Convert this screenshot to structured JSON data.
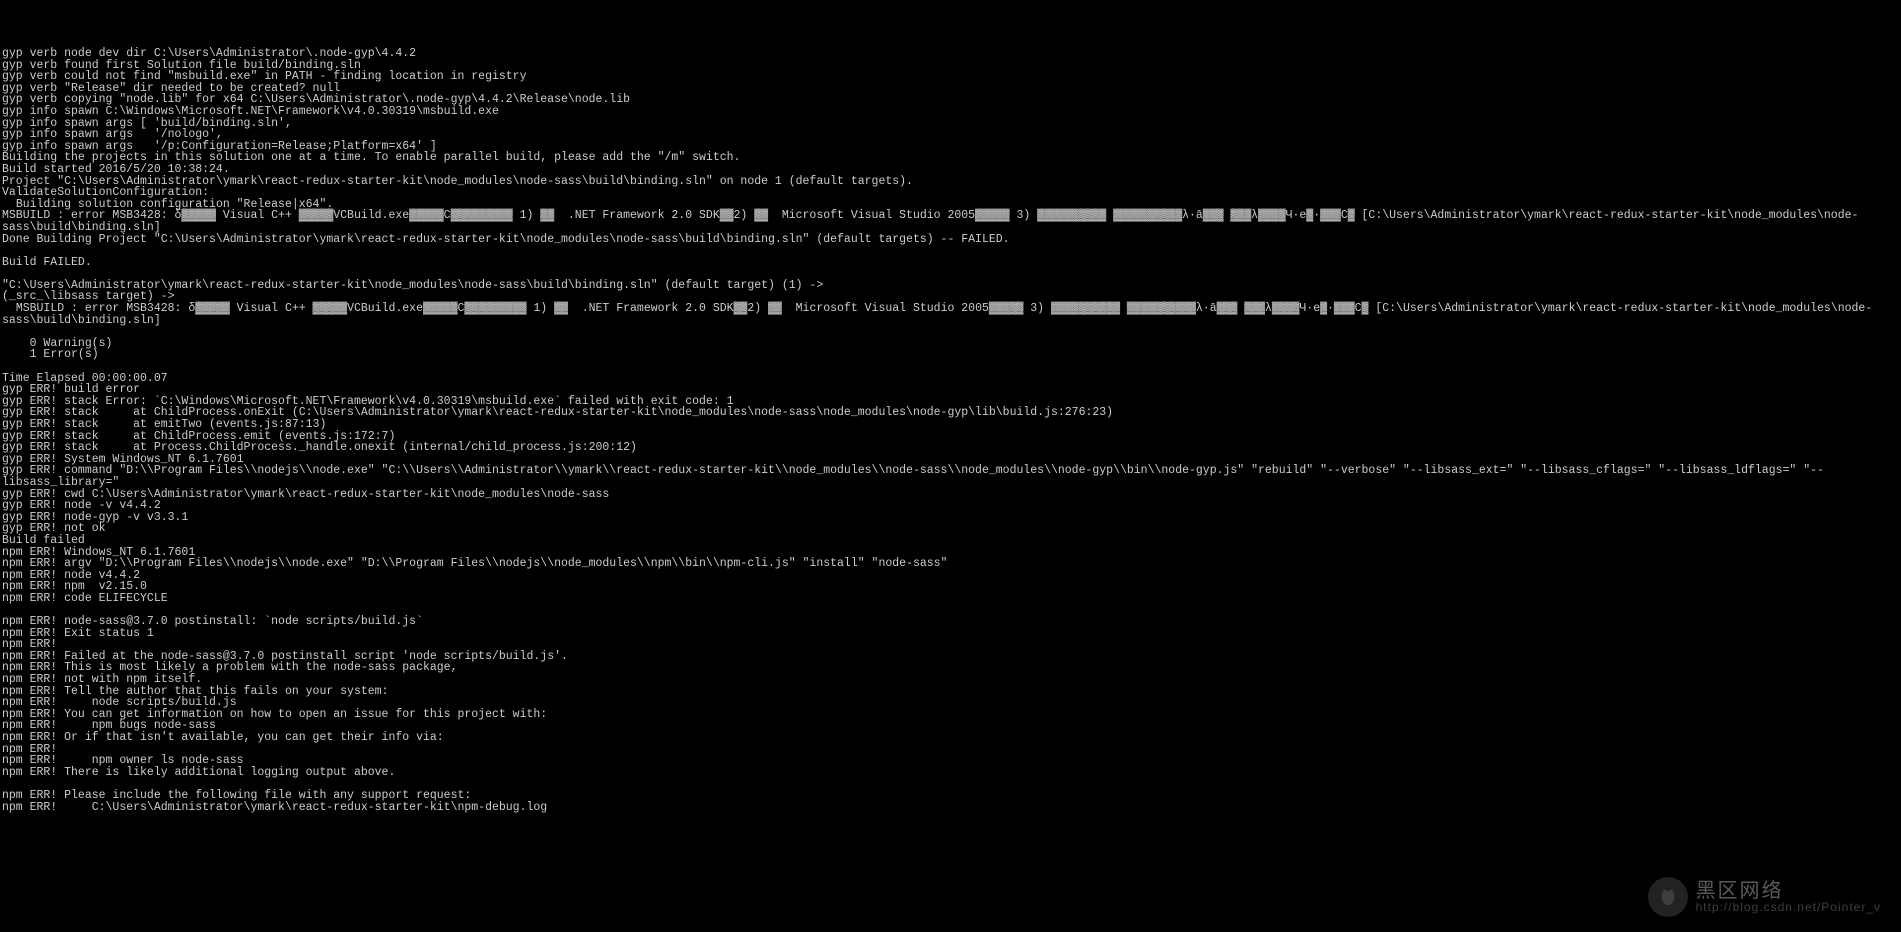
{
  "terminal": {
    "lines": [
      "gyp verb node dev dir C:\\Users\\Administrator\\.node-gyp\\4.4.2",
      "gyp verb found first Solution file build/binding.sln",
      "gyp verb could not find \"msbuild.exe\" in PATH - finding location in registry",
      "gyp verb \"Release\" dir needed to be created? null",
      "gyp verb copying \"node.lib\" for x64 C:\\Users\\Administrator\\.node-gyp\\4.4.2\\Release\\node.lib",
      "gyp info spawn C:\\Windows\\Microsoft.NET\\Framework\\v4.0.30319\\msbuild.exe",
      "gyp info spawn args [ 'build/binding.sln',",
      "gyp info spawn args   '/nologo',",
      "gyp info spawn args   '/p:Configuration=Release;Platform=x64' ]",
      "Building the projects in this solution one at a time. To enable parallel build, please add the \"/m\" switch.",
      "Build started 2016/5/20 10:38:24.",
      "Project \"C:\\Users\\Administrator\\ymark\\react-redux-starter-kit\\node_modules\\node-sass\\build\\binding.sln\" on node 1 (default targets).",
      "ValidateSolutionConfiguration:",
      "  Building solution configuration \"Release|x64\".",
      "MSBUILD : error MSB3428: δ▓▓▓▓▓ Visual C++ ▓▓▓▓▓VCBuild.exe▓▓▓▓▓C▓▓▓▓▓▓▓▓▓ 1) ▓▓  .NET Framework 2.0 SDK▓▓2) ▓▓  Microsoft Visual Studio 2005▓▓▓▓▓ 3) ▓▓▓▓▓▓▓▓▓▓ ▓▓▓▓▓▓▓▓▓▓λ·ā▓▓▓ ▓▓▓λ▓▓▓▓Ч·e▓·▓▓▓C▓ [C:\\Users\\Administrator\\ymark\\react-redux-starter-kit\\node_modules\\node-sass\\build\\binding.sln]",
      "Done Building Project \"C:\\Users\\Administrator\\ymark\\react-redux-starter-kit\\node_modules\\node-sass\\build\\binding.sln\" (default targets) -- FAILED.",
      "",
      "Build FAILED.",
      "",
      "\"C:\\Users\\Administrator\\ymark\\react-redux-starter-kit\\node_modules\\node-sass\\build\\binding.sln\" (default target) (1) ->",
      "(_src_\\libsass target) ->",
      "  MSBUILD : error MSB3428: δ▓▓▓▓▓ Visual C++ ▓▓▓▓▓VCBuild.exe▓▓▓▓▓C▓▓▓▓▓▓▓▓▓ 1) ▓▓  .NET Framework 2.0 SDK▓▓2) ▓▓  Microsoft Visual Studio 2005▓▓▓▓▓ 3) ▓▓▓▓▓▓▓▓▓▓ ▓▓▓▓▓▓▓▓▓▓λ·ā▓▓▓ ▓▓▓λ▓▓▓▓Ч·e▓·▓▓▓C▓ [C:\\Users\\Administrator\\ymark\\react-redux-starter-kit\\node_modules\\node-sass\\build\\binding.sln]",
      "",
      "    0 Warning(s)",
      "    1 Error(s)",
      "",
      "Time Elapsed 00:00:00.07",
      "gyp ERR! build error",
      "gyp ERR! stack Error: `C:\\Windows\\Microsoft.NET\\Framework\\v4.0.30319\\msbuild.exe` failed with exit code: 1",
      "gyp ERR! stack     at ChildProcess.onExit (C:\\Users\\Administrator\\ymark\\react-redux-starter-kit\\node_modules\\node-sass\\node_modules\\node-gyp\\lib\\build.js:276:23)",
      "gyp ERR! stack     at emitTwo (events.js:87:13)",
      "gyp ERR! stack     at ChildProcess.emit (events.js:172:7)",
      "gyp ERR! stack     at Process.ChildProcess._handle.onexit (internal/child_process.js:200:12)",
      "gyp ERR! System Windows_NT 6.1.7601",
      "gyp ERR! command \"D:\\\\Program Files\\\\nodejs\\\\node.exe\" \"C:\\\\Users\\\\Administrator\\\\ymark\\\\react-redux-starter-kit\\\\node_modules\\\\node-sass\\\\node_modules\\\\node-gyp\\\\bin\\\\node-gyp.js\" \"rebuild\" \"--verbose\" \"--libsass_ext=\" \"--libsass_cflags=\" \"--libsass_ldflags=\" \"--libsass_library=\"",
      "gyp ERR! cwd C:\\Users\\Administrator\\ymark\\react-redux-starter-kit\\node_modules\\node-sass",
      "gyp ERR! node -v v4.4.2",
      "gyp ERR! node-gyp -v v3.3.1",
      "gyp ERR! not ok",
      "Build failed",
      "npm ERR! Windows_NT 6.1.7601",
      "npm ERR! argv \"D:\\\\Program Files\\\\nodejs\\\\node.exe\" \"D:\\\\Program Files\\\\nodejs\\\\node_modules\\\\npm\\\\bin\\\\npm-cli.js\" \"install\" \"node-sass\"",
      "npm ERR! node v4.4.2",
      "npm ERR! npm  v2.15.0",
      "npm ERR! code ELIFECYCLE",
      "",
      "npm ERR! node-sass@3.7.0 postinstall: `node scripts/build.js`",
      "npm ERR! Exit status 1",
      "npm ERR!",
      "npm ERR! Failed at the node-sass@3.7.0 postinstall script 'node scripts/build.js'.",
      "npm ERR! This is most likely a problem with the node-sass package,",
      "npm ERR! not with npm itself.",
      "npm ERR! Tell the author that this fails on your system:",
      "npm ERR!     node scripts/build.js",
      "npm ERR! You can get information on how to open an issue for this project with:",
      "npm ERR!     npm bugs node-sass",
      "npm ERR! Or if that isn't available, you can get their info via:",
      "npm ERR!",
      "npm ERR!     npm owner ls node-sass",
      "npm ERR! There is likely additional logging output above.",
      "",
      "npm ERR! Please include the following file with any support request:",
      "npm ERR!     C:\\Users\\Administrator\\ymark\\react-redux-starter-kit\\npm-debug.log"
    ]
  },
  "watermark": {
    "main": "黑区网络",
    "sub": "http://blog.csdn.net/Pointer_v"
  }
}
